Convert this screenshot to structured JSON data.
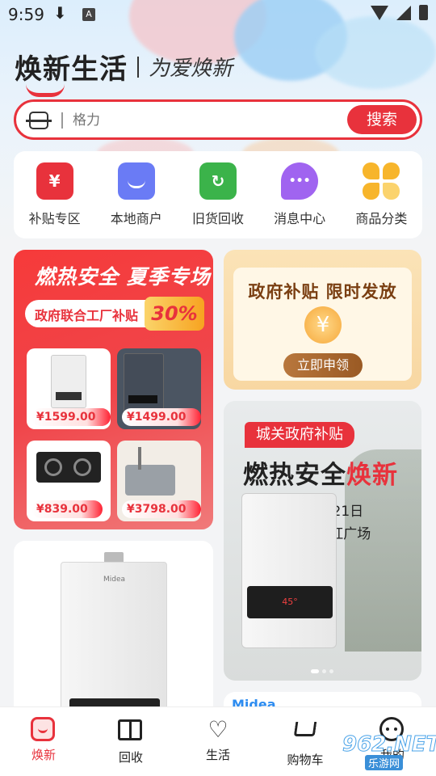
{
  "status_bar": {
    "time": "9:59",
    "download_glyph": "⬇",
    "notif_glyph": "A"
  },
  "header": {
    "brand": "焕新生活",
    "slogan": "为爱焕新"
  },
  "search": {
    "placeholder": "格力",
    "button": "搜索"
  },
  "categories": [
    {
      "label": "补贴专区",
      "icon": "red-envelope-icon",
      "glyph": "¥",
      "color": "#e8323c"
    },
    {
      "label": "本地商户",
      "icon": "shop-icon",
      "glyph": "",
      "color": "#6a7bf5"
    },
    {
      "label": "旧货回收",
      "icon": "recycle-icon",
      "glyph": "↻",
      "color": "#3bb34a"
    },
    {
      "label": "消息中心",
      "icon": "message-icon",
      "glyph": "•••",
      "color": "#a064f0"
    },
    {
      "label": "商品分类",
      "icon": "category-icon",
      "glyph": "",
      "color": "#f7b52b"
    }
  ],
  "promo": {
    "title": "燃热安全 夏季专场",
    "pill": "政府联合工厂补贴",
    "percent": "30%",
    "products": [
      {
        "price": "¥1599.00"
      },
      {
        "price": "¥1499.00"
      },
      {
        "price": "¥839.00"
      },
      {
        "price": "¥3798.00"
      }
    ]
  },
  "gov": {
    "title": "政府补贴 限时发放",
    "coin": "¥",
    "button": "立即申领"
  },
  "event": {
    "tag": "城关政府补贴",
    "headline_a": "燃热安全",
    "headline_b": "焕新",
    "date": "7月19日~7月21日",
    "location": "城关区东方红广场",
    "panel_readout": "45°"
  },
  "product": {
    "brand": "Midea"
  },
  "midea_card": {
    "brand": "Midea"
  },
  "tabs": [
    {
      "label": "焕新",
      "icon": "home-smile-icon",
      "active": true
    },
    {
      "label": "回收",
      "icon": "book-icon",
      "active": false
    },
    {
      "label": "生活",
      "icon": "heart-leaf-icon",
      "active": false
    },
    {
      "label": "购物车",
      "icon": "cart-icon",
      "active": false
    },
    {
      "label": "我的",
      "icon": "profile-icon",
      "active": false
    }
  ],
  "watermark": {
    "number": "962",
    "net": ".NET",
    "site": "乐游网"
  },
  "colors": {
    "accent": "#e8323c",
    "gold": "#9a5a24"
  }
}
